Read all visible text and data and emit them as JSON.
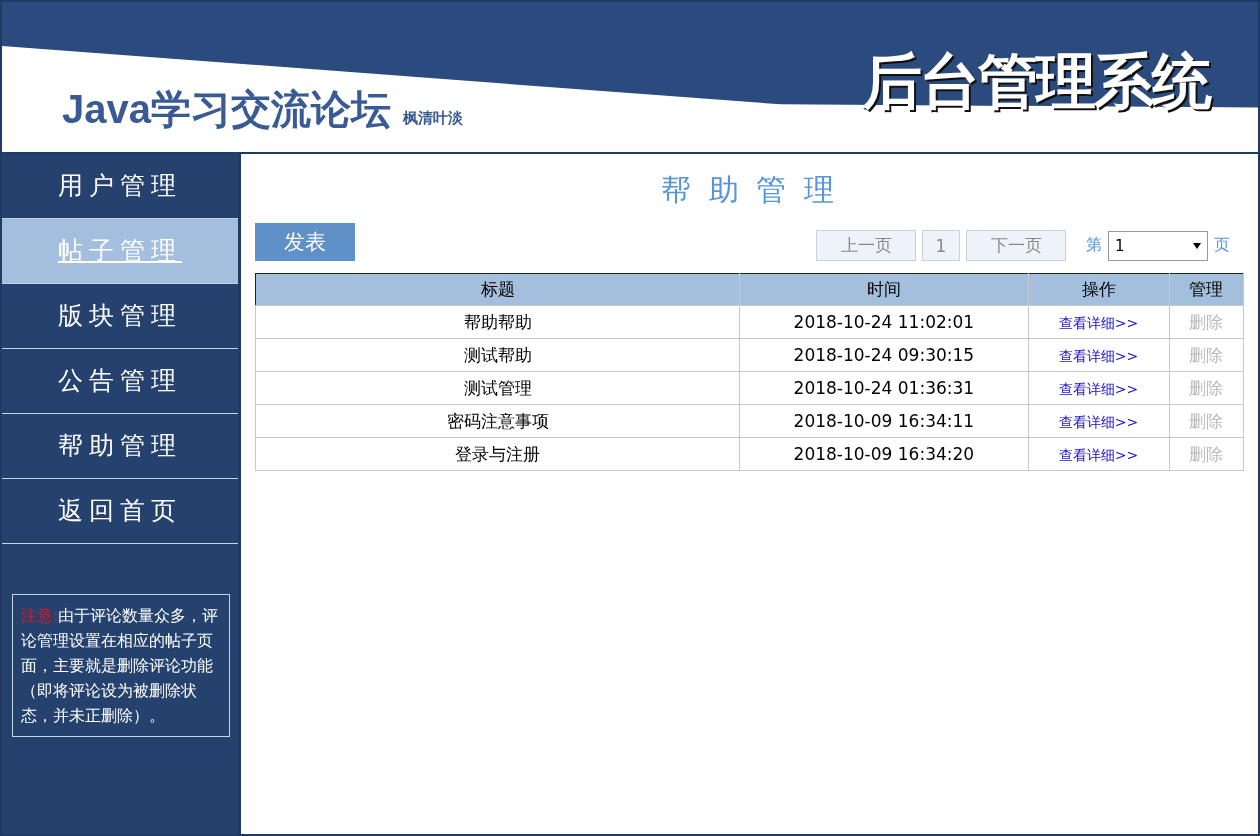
{
  "header": {
    "site_title": "Java学习交流论坛",
    "author": "枫清叶淡",
    "system_title": "后台管理系统"
  },
  "sidebar": {
    "items": [
      {
        "label": "用户管理",
        "selected": false
      },
      {
        "label": "帖子管理",
        "selected": true
      },
      {
        "label": "版块管理",
        "selected": false
      },
      {
        "label": "公告管理",
        "selected": false
      },
      {
        "label": "帮助管理",
        "selected": false
      },
      {
        "label": "返回首页",
        "selected": false
      }
    ],
    "note": {
      "label": "注意:",
      "text": "由于评论数量众多，评论管理设置在相应的帖子页面，主要就是删除评论功能（即将评论设为被删除状态，并未正删除）。"
    }
  },
  "main": {
    "title": "帮 助 管 理",
    "post_button": "发表",
    "pagination": {
      "prev": "上一页",
      "current": "1",
      "next": "下一页",
      "page_prefix": "第",
      "page_value": "1",
      "page_suffix": "页"
    },
    "table": {
      "columns": [
        "标题",
        "时间",
        "操作",
        "管理"
      ],
      "rows": [
        {
          "title": "帮助帮助",
          "time": "2018-10-24 11:02:01",
          "action": "查看详细>>",
          "manage": "删除"
        },
        {
          "title": "测试帮助",
          "time": "2018-10-24 09:30:15",
          "action": "查看详细>>",
          "manage": "删除"
        },
        {
          "title": "测试管理",
          "time": "2018-10-24 01:36:31",
          "action": "查看详细>>",
          "manage": "删除"
        },
        {
          "title": "密码注意事项",
          "time": "2018-10-09 16:34:11",
          "action": "查看详细>>",
          "manage": "删除"
        },
        {
          "title": "登录与注册",
          "time": "2018-10-09 16:34:20",
          "action": "查看详细>>",
          "manage": "删除"
        }
      ]
    }
  }
}
